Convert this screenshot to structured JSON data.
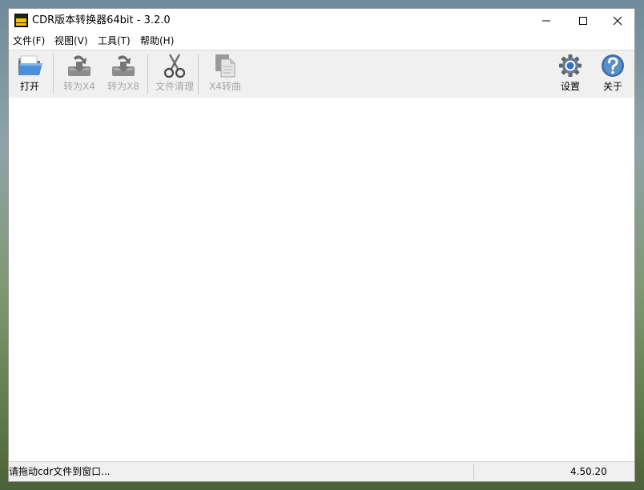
{
  "window": {
    "title": "CDR版本转换器64bit - 3.2.0",
    "app_icon": "cdr-version-app-icon",
    "controls": {
      "minimize": "minimize-icon",
      "maximize": "maximize-icon",
      "close": "close-icon"
    }
  },
  "menu": {
    "items": [
      "文件(F)",
      "视图(V)",
      "工具(T)",
      "帮助(H)"
    ]
  },
  "toolbar": {
    "buttons": [
      {
        "label": "打开",
        "icon": "folder-open-icon",
        "enabled": true
      },
      {
        "label": "转为X4",
        "icon": "convert-x4-icon",
        "enabled": false
      },
      {
        "label": "转为X8",
        "icon": "convert-x8-icon",
        "enabled": false
      },
      {
        "label": "文件清理",
        "icon": "scissors-icon",
        "enabled": false
      },
      {
        "label": "X4转曲",
        "icon": "copy-curves-icon",
        "enabled": false
      },
      {
        "label": "设置",
        "icon": "gear-icon",
        "enabled": true
      },
      {
        "label": "关于",
        "icon": "help-icon",
        "enabled": true
      }
    ]
  },
  "status": {
    "message": "请拖动cdr文件到窗口...",
    "version": "4.50.20"
  },
  "colors": {
    "window_bg": "#ffffff",
    "toolbar_bg": "#f0f0f0",
    "disabled_text": "#a8a8a8",
    "accent_blue": "#3a6ea5"
  }
}
